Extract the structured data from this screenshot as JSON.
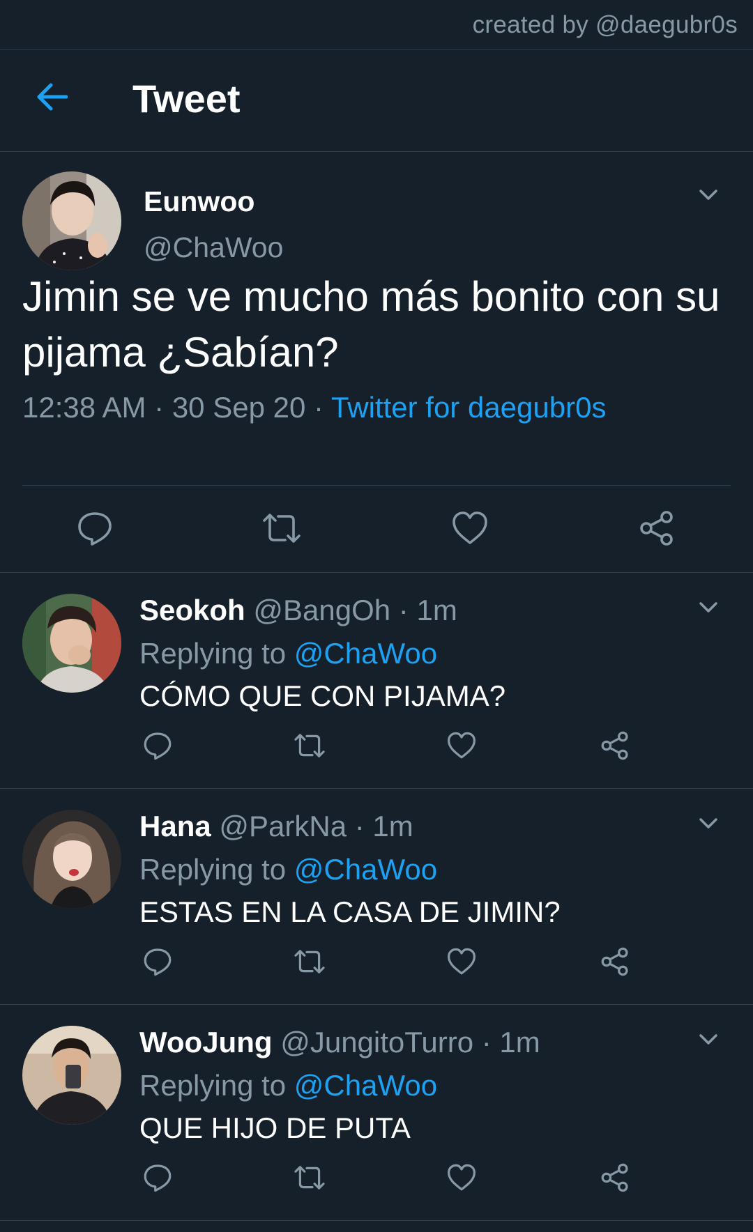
{
  "watermark": "created by @daegubr0s",
  "header": {
    "title": "Tweet"
  },
  "main_tweet": {
    "name": "Eunwoo",
    "handle": "@ChaWoo",
    "text": "Jimin se ve mucho más bonito con su pijama ¿Sabían?",
    "time": "12:38 AM",
    "date": "30 Sep 20",
    "separator": "·",
    "source": "Twitter for daegubr0s"
  },
  "replies": [
    {
      "name": "Seokoh",
      "handle": "@BangOh",
      "time": "1m",
      "replying_label": "Replying to",
      "replying_to": "@ChaWoo",
      "text": "CÓMO QUE CON PIJAMA?"
    },
    {
      "name": "Hana",
      "handle": "@ParkNa",
      "time": "1m",
      "replying_label": "Replying to",
      "replying_to": "@ChaWoo",
      "text": "ESTAS EN LA CASA DE JIMIN?"
    },
    {
      "name": "WooJung",
      "handle": "@JungitoTurro",
      "time": "1m",
      "replying_label": "Replying to",
      "replying_to": "@ChaWoo",
      "text": "QUE HIJO DE PUTA"
    }
  ],
  "colors": {
    "background": "#15202b",
    "accent": "#1da1f2",
    "secondary_text": "#8899a6",
    "divider": "#2f3e4c"
  },
  "icons": {
    "back": "arrow-left-icon",
    "caret": "chevron-down-icon",
    "reply": "reply-icon",
    "retweet": "retweet-icon",
    "like": "heart-icon",
    "share": "share-icon"
  }
}
